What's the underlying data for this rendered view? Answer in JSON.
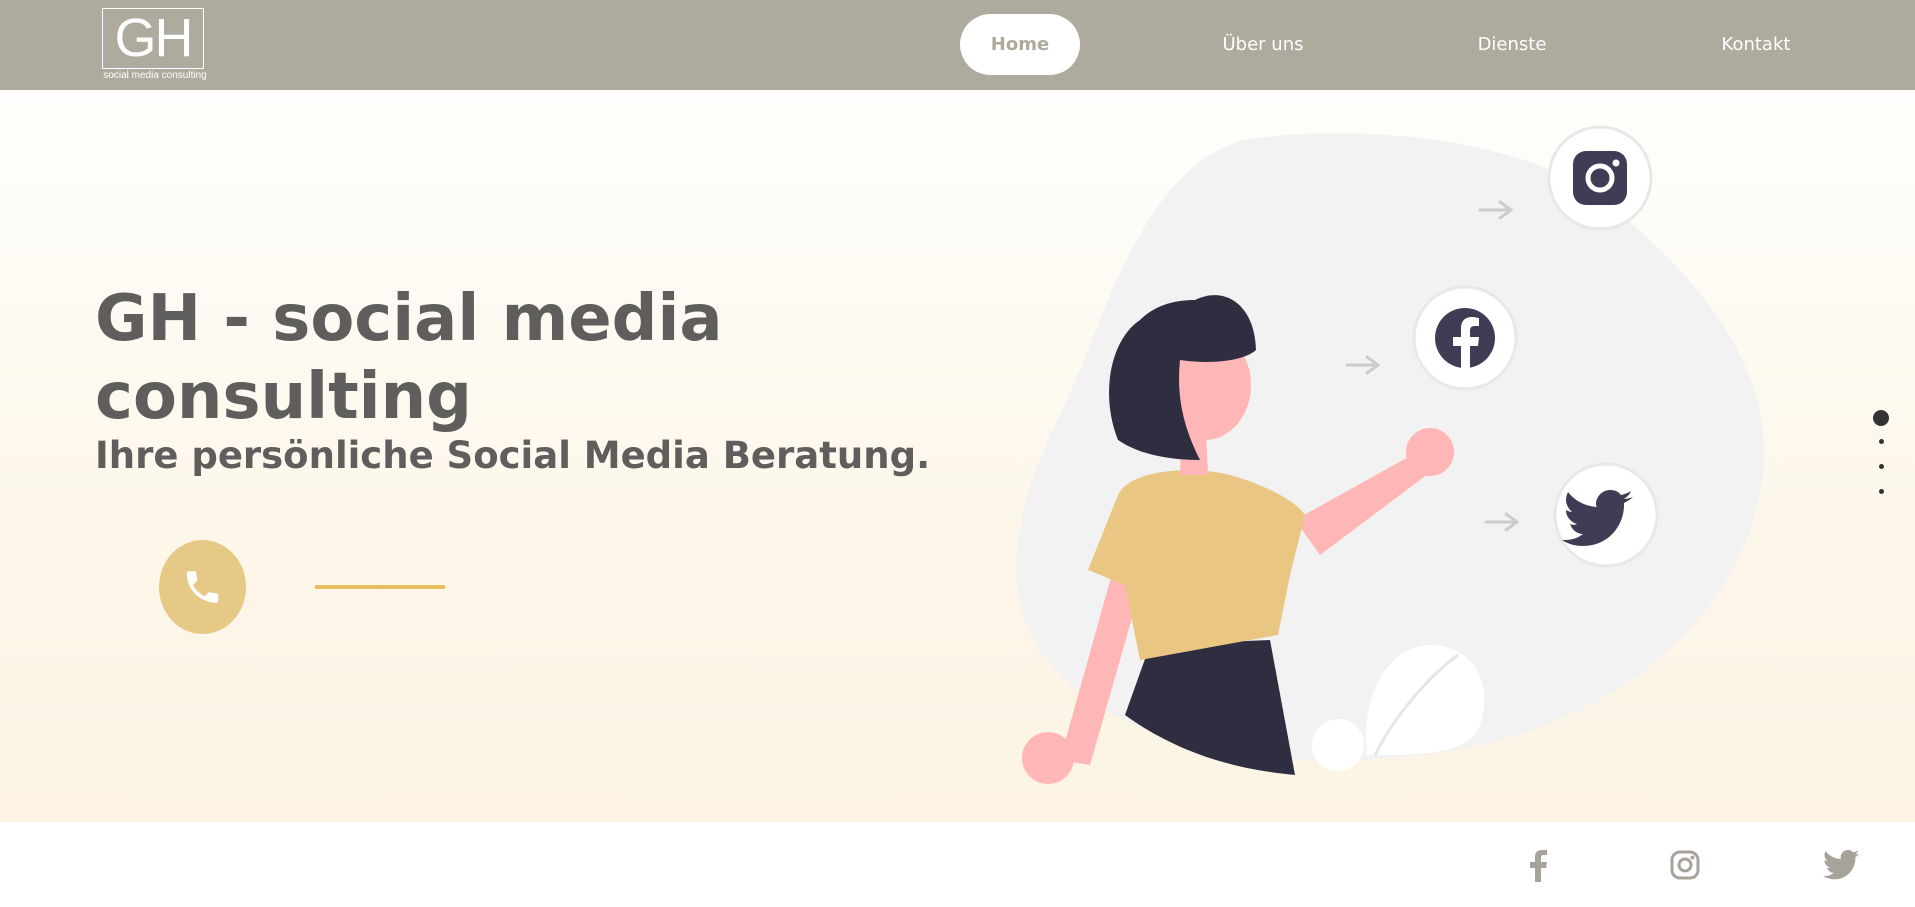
{
  "header": {
    "logo_mark": "GH",
    "logo_subtitle": "social media consulting",
    "nav": [
      {
        "label": "Home",
        "active": true
      },
      {
        "label": "Über uns",
        "active": false
      },
      {
        "label": "Dienste",
        "active": false
      },
      {
        "label": "Kontakt",
        "active": false
      }
    ]
  },
  "hero": {
    "title": "GH - social media consulting",
    "subtitle": "Ihre persönliche Social Media Beratung.",
    "call_icon": "phone-icon",
    "illustration_icons": [
      "instagram-icon",
      "facebook-icon",
      "twitter-icon"
    ]
  },
  "pagination": {
    "count": 4,
    "active_index": 0
  },
  "footer": {
    "social_icons": [
      "facebook-icon",
      "instagram-icon",
      "twitter-icon"
    ]
  },
  "colors": {
    "header_bg": "#afaa9e",
    "accent": "#e6c887",
    "text": "#605e5c",
    "illustration_dark": "#2f2e41",
    "skin": "#ffb6b6"
  }
}
